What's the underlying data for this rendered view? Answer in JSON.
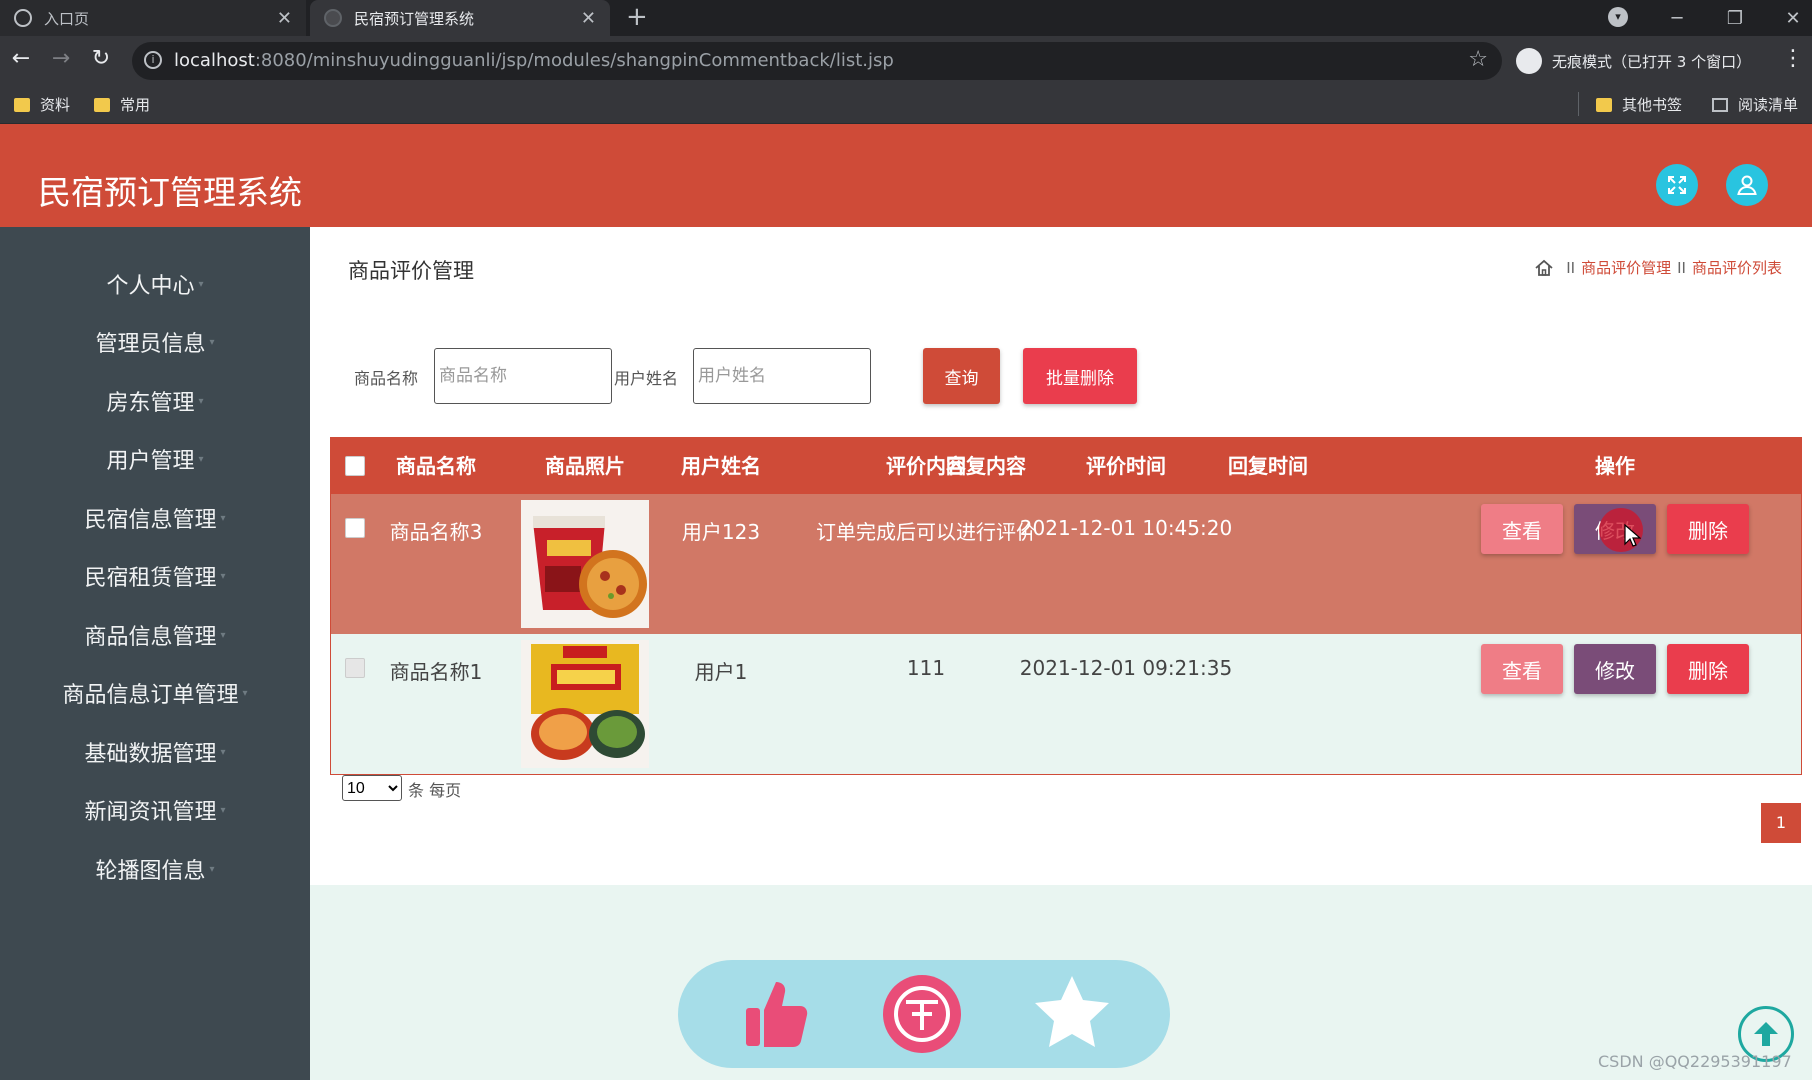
{
  "browser": {
    "tabs": [
      {
        "label": "入口页",
        "close": "✕"
      },
      {
        "label": "民宿预订管理系统",
        "close": "✕"
      }
    ],
    "new_tab": "+",
    "window_controls": [
      "─",
      "❐",
      "✕"
    ],
    "url_host": "localhost",
    "url_rest": ":8080/minshuyudingguanli/jsp/modules/shangpinCommentback/list.jsp",
    "incognito_text": "无痕模式（已打开 3 个窗口）",
    "bookmarks": [
      "资料",
      "常用"
    ],
    "bookmarks_right": [
      "其他书签",
      "阅读清单"
    ]
  },
  "app": {
    "title": "民宿预订管理系统",
    "accent_color": "#cf4b38"
  },
  "sidebar": {
    "items": [
      {
        "label": "个人中心"
      },
      {
        "label": "管理员信息"
      },
      {
        "label": "房东管理"
      },
      {
        "label": "用户管理"
      },
      {
        "label": "民宿信息管理"
      },
      {
        "label": "民宿租赁管理"
      },
      {
        "label": "商品信息管理"
      },
      {
        "label": "商品信息订单管理"
      },
      {
        "label": "基础数据管理"
      },
      {
        "label": "新闻资讯管理"
      },
      {
        "label": "轮播图信息"
      }
    ]
  },
  "main": {
    "heading": "商品评价管理",
    "breadcrumb": {
      "separator": "II",
      "items": [
        "商品评价管理",
        "商品评价列表"
      ]
    },
    "search": {
      "product_label": "商品名称",
      "product_placeholder": "商品名称",
      "user_label": "用户姓名",
      "user_placeholder": "用户姓名",
      "query_label": "查询",
      "bulk_delete_label": "批量删除"
    },
    "table": {
      "columns": [
        "商品名称",
        "商品照片",
        "用户姓名",
        "评价内容",
        "回复内容",
        "评价时间",
        "回复时间",
        "操作"
      ],
      "rows": [
        {
          "product": "商品名称3",
          "photo": "instant-noodle-cup",
          "user": "用户123",
          "comment": "订单完成后可以进行评价",
          "reply": "",
          "comment_time": "2021-12-01 10:45:20",
          "reply_time": "",
          "actions": [
            "查看",
            "修改",
            "删除"
          ]
        },
        {
          "product": "商品名称1",
          "photo": "snail-noodle-pack",
          "user": "用户1",
          "comment": "111",
          "reply": "",
          "comment_time": "2021-12-01 09:21:35",
          "reply_time": "",
          "actions": [
            "查看",
            "修改",
            "删除"
          ]
        }
      ]
    },
    "pagination": {
      "page_size": "10",
      "page_size_suffix": "条 每页",
      "current_page": "1"
    }
  },
  "floating_bar": {
    "icons": [
      "thumbs-up-icon",
      "coin-icon",
      "star-icon"
    ],
    "color": "#a6dde8"
  },
  "watermark": "CSDN @QQ2295391197"
}
